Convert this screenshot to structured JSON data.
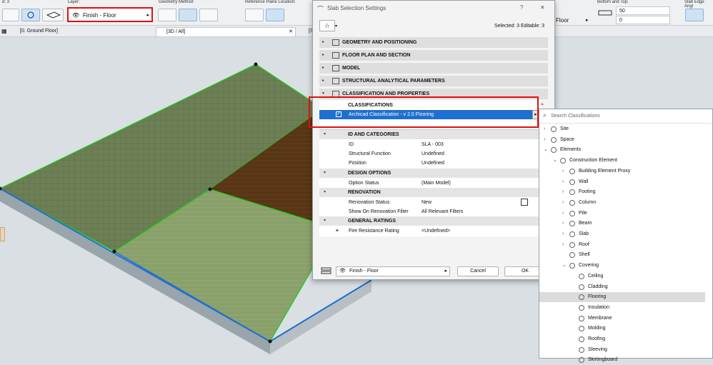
{
  "toolbar": {
    "left_label": "d: 3",
    "layer_group_label": "Layer:",
    "layer_value": "Finish - Floor",
    "geometry_label": "Geometry Method:",
    "reference_label": "Reference Plane Location:",
    "floor_value": "Floor",
    "bottom_top_label": "Bottom and Top:",
    "bottom_value": "50",
    "top_value": "0",
    "edge_label": "Slab Edge Angl"
  },
  "tabs": {
    "ground_floor": "[0. Ground Floor]",
    "view_3d": "[3D / All]",
    "partial": "[S"
  },
  "dialog": {
    "title": "Slab Selection Settings",
    "help": "?",
    "close": "✕",
    "selected_info": "Selected: 3 Editable: 3",
    "sections": [
      "GEOMETRY AND POSITIONING",
      "FLOOR PLAN AND SECTION",
      "MODEL",
      "STRUCTURAL ANALYTICAL PARAMETERS",
      "CLASSIFICATION AND PROPERTIES"
    ],
    "classifications_header": "CLASSIFICATIONS",
    "classification_row": "Archicad Classification - v 2.0  Flooring",
    "id_group": "ID AND CATEGORIES",
    "props": [
      {
        "k": "ID",
        "v": "SLA - 003"
      },
      {
        "k": "Structural Function",
        "v": "Undefined"
      },
      {
        "k": "Position",
        "v": "Undefined"
      }
    ],
    "design_group": "DESIGN OPTIONS",
    "option_status_k": "Option Status",
    "option_status_v": "(Main Model)",
    "renovation_group": "RENOVATION",
    "renovation_status_k": "Renovation Status",
    "renovation_status_v": "New",
    "show_filter_k": "Show On Renovation Filter",
    "show_filter_v": "All Relevant Filters",
    "ratings_group": "GENERAL RATINGS",
    "fire_k": "Fire Resistance Rating",
    "fire_v": "<Undefined>",
    "bottom_layer": "Finish - Floor",
    "cancel": "Cancel",
    "ok": "OK"
  },
  "panel": {
    "search_placeholder": "Search Classifications",
    "items": [
      {
        "label": "Site"
      },
      {
        "label": "Space"
      },
      {
        "label": "Elements"
      },
      {
        "label": "Construction Element"
      },
      {
        "label": "Building Element Proxy"
      },
      {
        "label": "Wall"
      },
      {
        "label": "Footing"
      },
      {
        "label": "Column"
      },
      {
        "label": "Pile"
      },
      {
        "label": "Beam"
      },
      {
        "label": "Slab"
      },
      {
        "label": "Roof"
      },
      {
        "label": "Shell"
      },
      {
        "label": "Covering"
      },
      {
        "label": "Ceiling"
      },
      {
        "label": "Cladding"
      },
      {
        "label": "Flooring"
      },
      {
        "label": "Insulation"
      },
      {
        "label": "Membrane"
      },
      {
        "label": "Molding"
      },
      {
        "label": "Roofing"
      },
      {
        "label": "Sleeving"
      },
      {
        "label": "Skirtingboard"
      }
    ]
  },
  "colors": {
    "highlight_red": "#e01010",
    "selection_blue": "#1e6fd0",
    "slab_green": "#7f9a5a",
    "slab_brown": "#5a3818"
  }
}
